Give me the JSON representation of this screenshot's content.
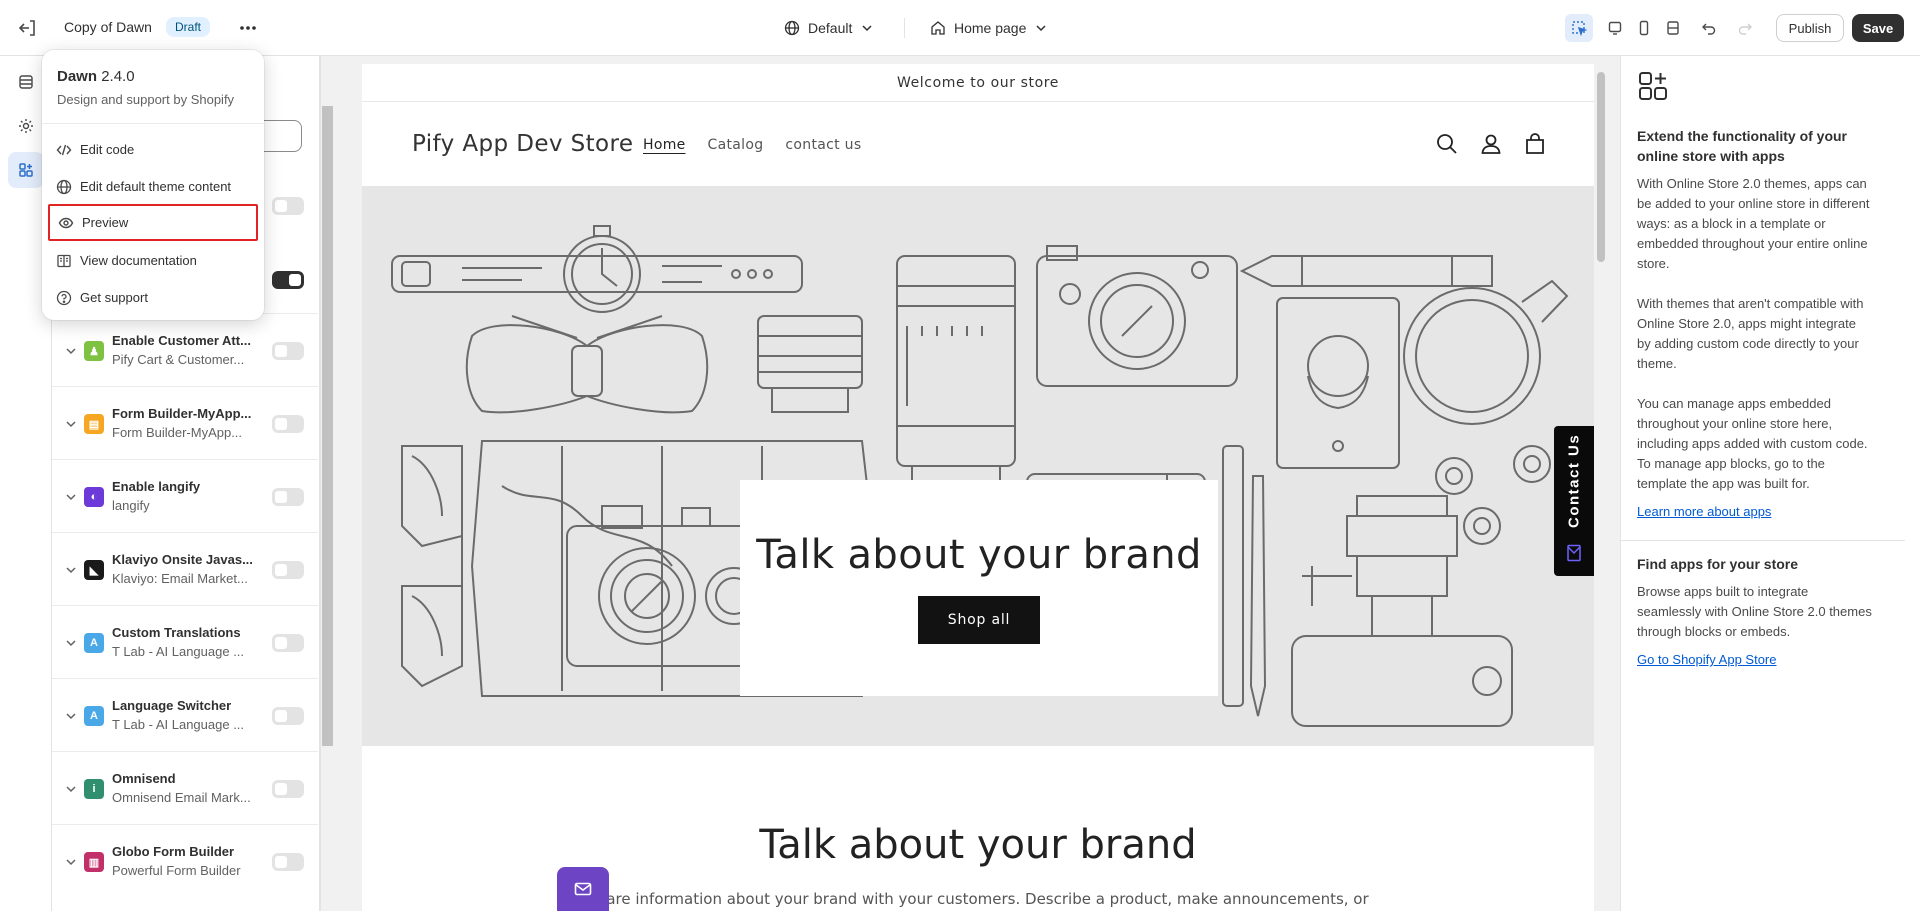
{
  "topbar": {
    "theme_title": "Copy of Dawn",
    "status_badge": "Draft",
    "locale_select": "Default",
    "template_select": "Home page",
    "publish_label": "Publish",
    "save_label": "Save"
  },
  "menu": {
    "theme_name": "Dawn",
    "theme_version": "2.4.0",
    "theme_support": "Design and support by Shopify",
    "items": [
      {
        "label": "Edit code",
        "icon": "code-icon"
      },
      {
        "label": "Edit default theme content",
        "icon": "globe-icon"
      },
      {
        "label": "Preview",
        "icon": "eye-icon",
        "highlighted": true
      },
      {
        "label": "View documentation",
        "icon": "book-icon"
      },
      {
        "label": "Get support",
        "icon": "help-icon"
      }
    ]
  },
  "apps": [
    {
      "name": "Enable Customer Att...",
      "sub": "Pify Cart & Customer...",
      "color": "#7fc242",
      "glyph": "♟",
      "enabled": false
    },
    {
      "name": "Form Builder-MyApp...",
      "sub": "Form Builder-MyApp...",
      "color": "#f5a623",
      "glyph": "▤",
      "enabled": false
    },
    {
      "name": "Enable langify",
      "sub": "langify",
      "color": "#6b3ad8",
      "glyph": "◐",
      "enabled": false
    },
    {
      "name": "Klaviyo Onsite Javas...",
      "sub": "Klaviyo: Email Market...",
      "color": "#1a1a1a",
      "glyph": "◣",
      "enabled": false
    },
    {
      "name": "Custom Translations",
      "sub": "T Lab - AI Language ...",
      "color": "#4aa8e8",
      "glyph": "A",
      "enabled": false
    },
    {
      "name": "Language Switcher",
      "sub": "T Lab - AI Language ...",
      "color": "#4aa8e8",
      "glyph": "A",
      "enabled": false
    },
    {
      "name": "Omnisend",
      "sub": "Omnisend Email Mark...",
      "color": "#2f8f6f",
      "glyph": "i",
      "enabled": false
    },
    {
      "name": "Globo Form Builder",
      "sub": "Powerful Form Builder",
      "color": "#c2306a",
      "glyph": "▥",
      "enabled": false
    }
  ],
  "preview": {
    "announcement": "Welcome to our store",
    "store_name": "Pify App Dev Store",
    "nav": [
      "Home",
      "Catalog",
      "contact us"
    ],
    "hero_title": "Talk about your brand",
    "hero_button": "Shop all",
    "contact_tab": "Contact Us",
    "section2_title": "Talk about your brand",
    "section2_text": "Share information about your brand with your customers. Describe a product, make announcements, or"
  },
  "right_panel": {
    "heading": "Extend the functionality of your online store with apps",
    "para1": "With Online Store 2.0 themes, apps can be added to your online store in different ways: as a block in a template or embedded throughout your entire online store.",
    "para2": "With themes that aren't compatible with Online Store 2.0, apps might integrate by adding custom code directly to your theme.",
    "para3": "You can manage apps embedded throughout your online store here, including apps added with custom code. To manage app blocks, go to the template the app was built for.",
    "link1": "Learn more about apps",
    "heading2": "Find apps for your store",
    "para4": "Browse apps built to integrate seamlessly with Online Store 2.0 themes through blocks or embeds.",
    "link2": "Go to Shopify App Store"
  },
  "colors": {
    "accent": "#2c6ecb",
    "highlight_border": "#e02424",
    "save_bg": "#303030",
    "badge_bg": "#e0f0ff"
  }
}
